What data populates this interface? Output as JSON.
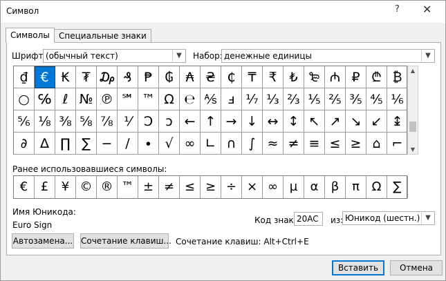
{
  "window": {
    "title": "Символ",
    "help_glyph": "?",
    "close_glyph": "✕"
  },
  "tabs": [
    {
      "label": "Символы",
      "active": true
    },
    {
      "label": "Специальные знаки",
      "active": false
    }
  ],
  "font": {
    "label": "Шрифт:",
    "value": "(обычный текст)"
  },
  "subset": {
    "label": "Набор:",
    "value": "денежные единицы"
  },
  "symbol_grid": [
    [
      "₫",
      "€",
      "₭",
      "₮",
      "₯",
      "₰",
      "₱",
      "₲",
      "₳",
      "₴",
      "₵",
      "₸",
      "₹",
      "₺",
      "₻",
      "₼",
      "₽",
      "₾",
      "₿"
    ],
    [
      "○",
      "℅",
      "ℓ",
      "№",
      "℗",
      "℠",
      "™",
      "Ω",
      "℮",
      "⅍",
      "ⅎ",
      "⅐",
      "⅓",
      "⅔",
      "⅕",
      "⅖",
      "⅗",
      "⅘",
      "⅙"
    ],
    [
      "⅚",
      "⅛",
      "⅜",
      "⅝",
      "⅞",
      "⅟",
      "Ↄ",
      "ↄ",
      "←",
      "↑",
      "→",
      "↓",
      "↔",
      "↕",
      "↖",
      "↗",
      "↘",
      "↙",
      "↨"
    ],
    [
      "∂",
      "∆",
      "∏",
      "∑",
      "−",
      "∕",
      "∙",
      "√",
      "∞",
      "∟",
      "∩",
      "∫",
      "≈",
      "≠",
      "≡",
      "≤",
      "≥",
      "⌂",
      "⌐"
    ]
  ],
  "selected_symbol": "€",
  "recent": {
    "label": "Ранее использовавшиеся символы:",
    "symbols": [
      "€",
      "£",
      "¥",
      "©",
      "®",
      "™",
      "±",
      "≠",
      "≤",
      "≥",
      "÷",
      "×",
      "∞",
      "µ",
      "α",
      "β",
      "π",
      "Ω",
      "∑"
    ]
  },
  "unicode_name": {
    "label": "Имя Юникода:",
    "value": "Euro Sign"
  },
  "char_code": {
    "label": "Код знака:",
    "value": "20AC"
  },
  "from": {
    "label": "из:",
    "value": "Юникод (шестн.)"
  },
  "buttons": {
    "autocorrect": "Автозамена...",
    "shortcut_key": "Сочетание клавиш...",
    "insert": "Вставить",
    "cancel": "Отмена"
  },
  "shortcut_text": "Сочетание клавиш: Alt+Ctrl+E"
}
